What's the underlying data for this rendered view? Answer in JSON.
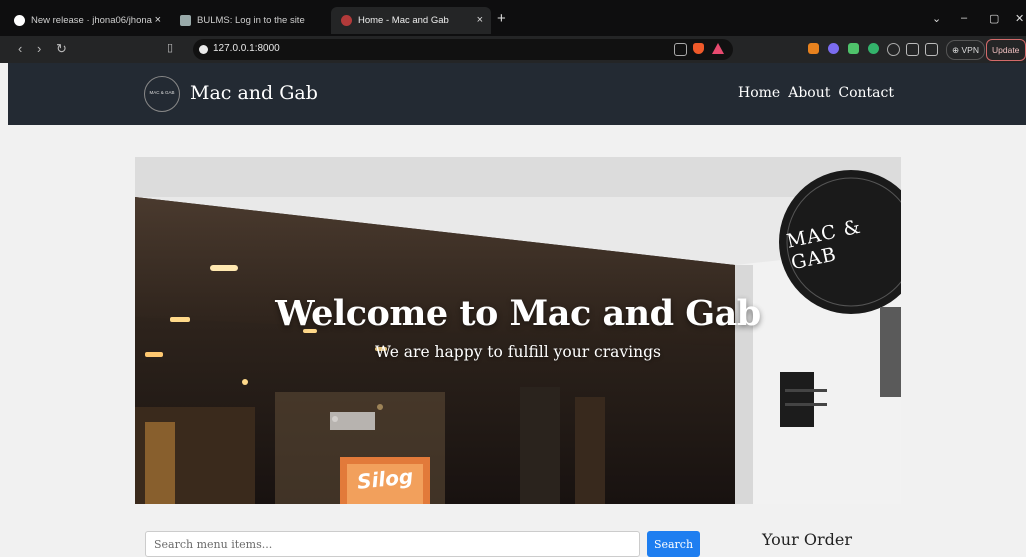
{
  "browser": {
    "tabs": [
      {
        "label": "New release · jhona06/jhona",
        "close": "×"
      },
      {
        "label": "BULMS: Log in to the site",
        "close": "×"
      },
      {
        "label": "Home - Mac and Gab",
        "close": "×"
      }
    ],
    "new_tab": "+",
    "url": "127.0.0.1:8000",
    "vpn_label": "VPN",
    "update_label": "Update"
  },
  "site": {
    "logo_text": "MAC & GAB",
    "brand": "Mac and Gab",
    "nav": [
      "Home",
      "About",
      "Contact"
    ]
  },
  "hero": {
    "title": "Welcome to Mac and Gab",
    "subtitle": "We are happy to fulfill your cravings",
    "sign_text": "MAC & GAB",
    "banner_text": "Silog"
  },
  "search": {
    "placeholder": "Search menu items...",
    "button": "Search"
  },
  "order": {
    "title": "Your Order"
  },
  "colors": {
    "header_bg": "#232a33",
    "accent_blue": "#1e7ef0",
    "page_bg": "#f1f1f1"
  }
}
